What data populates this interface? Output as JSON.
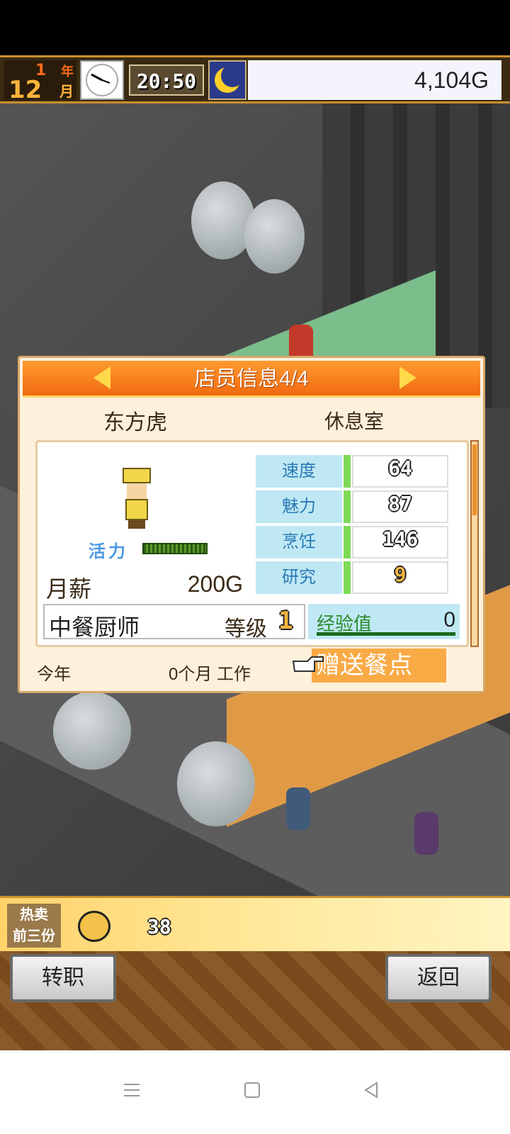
{
  "hud": {
    "year_num": "1",
    "year_unit": "年",
    "month_num": "12",
    "month_unit": "月",
    "time": "20:50",
    "money": "4,104G"
  },
  "dialog": {
    "title": "店员信息4/4",
    "staff_name": "东方虎",
    "location": "休息室",
    "energy_label": "活力",
    "salary_label": "月薪",
    "salary_value": "200G",
    "stats": [
      {
        "name": "速度",
        "value": "64"
      },
      {
        "name": "魅力",
        "value": "87"
      },
      {
        "name": "烹饪",
        "value": "146"
      },
      {
        "name": "研究",
        "value": "9"
      }
    ],
    "job_title": "中餐厨师",
    "level_label": "等级",
    "level_value": "1",
    "exp_label": "经验值",
    "exp_value": "0",
    "footer_year": "今年",
    "footer_work": "0个月 工作",
    "gift_label": "赠送餐点"
  },
  "hot": {
    "label_line1": "热卖",
    "label_line2": "前三份",
    "count": "38"
  },
  "buttons": {
    "left": "转职",
    "right": "返回"
  },
  "icons": {
    "clock": "clock-icon",
    "moon": "moon-icon",
    "arrow_left": "arrow-left-icon",
    "arrow_right": "arrow-right-icon",
    "hand": "pointing-hand-icon",
    "menu": "menu-icon",
    "home": "home-icon",
    "back": "back-icon"
  },
  "colors": {
    "header_orange": "#f06a10",
    "stat_bg": "#bfe8f4",
    "gift_orange": "#f9aa45"
  }
}
